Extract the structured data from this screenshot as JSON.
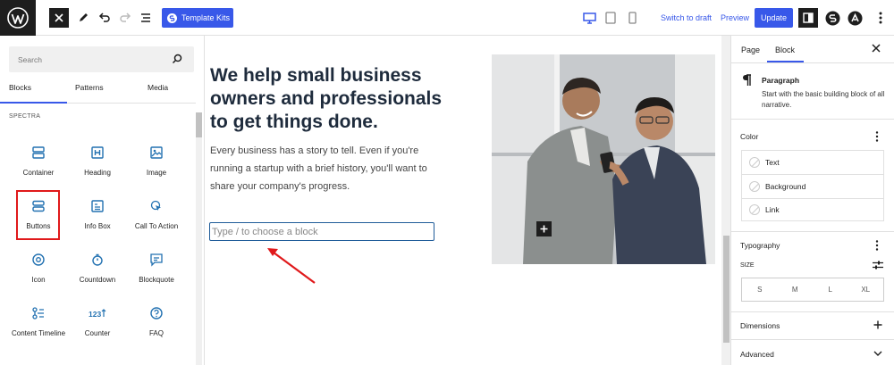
{
  "toolbar": {
    "template_kits_label": "Template Kits",
    "switch_to_draft": "Switch to draft",
    "preview": "Preview",
    "update": "Update"
  },
  "inserter": {
    "search_placeholder": "Search",
    "tabs": [
      "Blocks",
      "Patterns",
      "Media"
    ],
    "category": "SPECTRA",
    "blocks": [
      {
        "label": "Container",
        "icon": "container-icon"
      },
      {
        "label": "Heading",
        "icon": "heading-icon"
      },
      {
        "label": "Image",
        "icon": "image-icon"
      },
      {
        "label": "Buttons",
        "icon": "buttons-icon"
      },
      {
        "label": "Info Box",
        "icon": "info-box-icon"
      },
      {
        "label": "Call To Action",
        "icon": "call-to-action-icon"
      },
      {
        "label": "Icon",
        "icon": "icon-block-icon"
      },
      {
        "label": "Countdown",
        "icon": "countdown-icon"
      },
      {
        "label": "Blockquote",
        "icon": "blockquote-icon"
      },
      {
        "label": "Content Timeline",
        "icon": "content-timeline-icon"
      },
      {
        "label": "Counter",
        "icon": "counter-icon"
      },
      {
        "label": "FAQ",
        "icon": "faq-icon"
      }
    ],
    "highlight_color": "#e0191b"
  },
  "canvas": {
    "heading": "We help small business owners and professionals to get things done.",
    "paragraph": "Every business has a story to tell. Even if you're running a startup with a brief history, you'll want to share your company's progress.",
    "block_placeholder": "Type / to choose a block",
    "arrow_color": "#e0191b"
  },
  "sidebar": {
    "tabs": [
      "Page",
      "Block"
    ],
    "block_title": "Paragraph",
    "block_description": "Start with the basic building block of all narrative.",
    "color_section": "Color",
    "color_items": [
      "Text",
      "Background",
      "Link"
    ],
    "typography_section": "Typography",
    "size_label": "SIZE",
    "sizes": [
      "S",
      "M",
      "L",
      "XL"
    ],
    "dimensions_section": "Dimensions",
    "advanced_section": "Advanced"
  },
  "colors": {
    "accent": "#3858e9",
    "dark": "#1e1e1e"
  }
}
